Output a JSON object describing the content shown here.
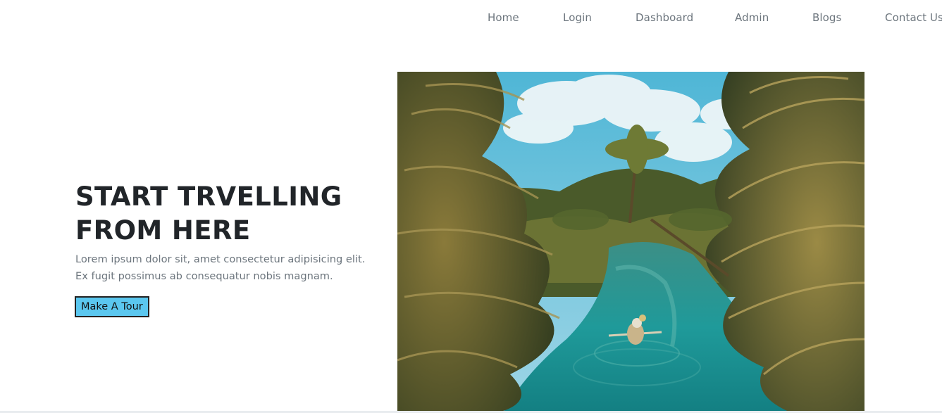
{
  "nav": {
    "links": [
      {
        "label": "Home"
      },
      {
        "label": "Login"
      },
      {
        "label": "Dashboard"
      },
      {
        "label": "Admin"
      },
      {
        "label": "Blogs"
      },
      {
        "label": "Contact Us"
      }
    ]
  },
  "hero": {
    "title_line1": "START TRVELLING",
    "title_line2": "FROM HERE",
    "text": "Lorem ipsum dolor sit, amet consectetur adipisicing elit. Ex fugit possimus ab consequatur nobis magnam.",
    "button_label": "Make A Tour",
    "button_color": "#5bc7ef"
  }
}
